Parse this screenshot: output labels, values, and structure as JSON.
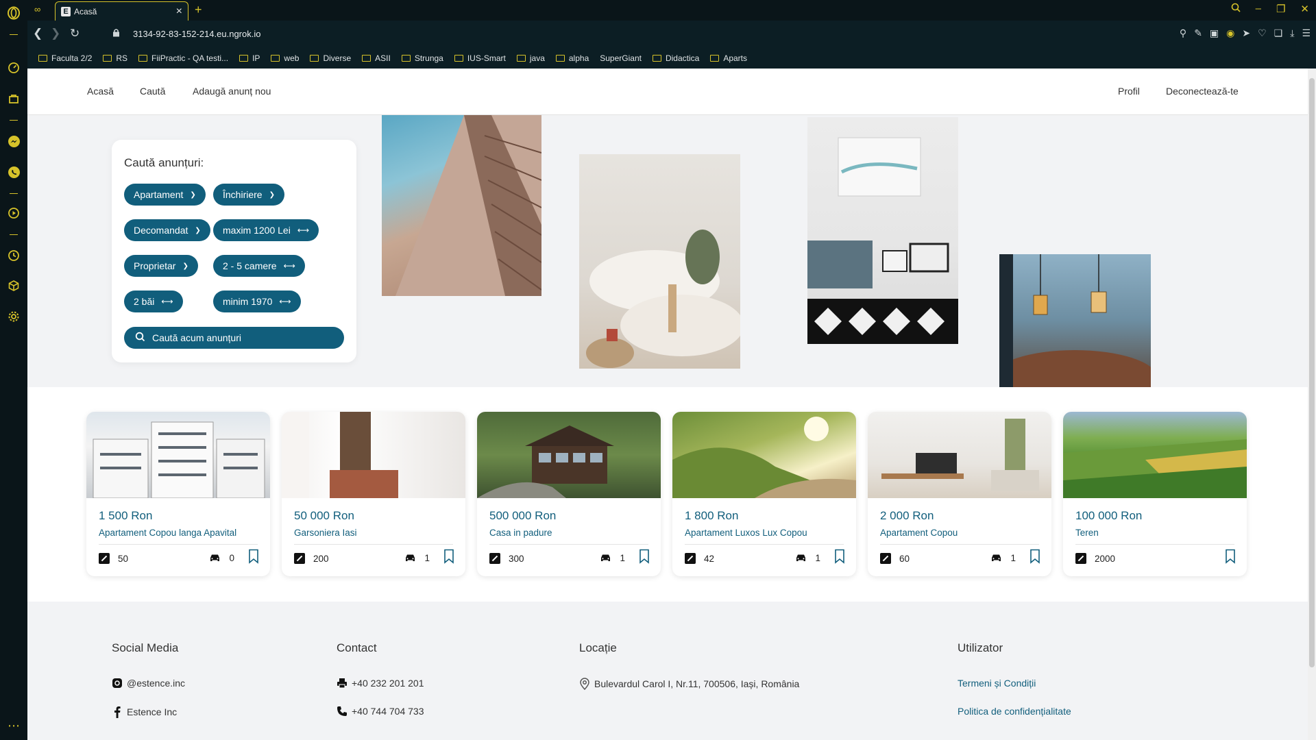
{
  "browser": {
    "tab_title": "Acasă",
    "tab_favicon_letter": "E",
    "url": "3134-92-83-152-214.eu.ngrok.io",
    "bookmarks": [
      "Faculta 2/2",
      "RS",
      "FiiPractic - QA testi...",
      "IP",
      "web",
      "Diverse",
      "ASII",
      "Strunga",
      "IUS-Smart",
      "java",
      "alpha",
      "SuperGiant",
      "Didactica",
      "Aparts"
    ],
    "accent_color": "#d7c32a"
  },
  "nav": {
    "home": "Acasă",
    "search": "Caută",
    "add": "Adaugă anunț nou",
    "profile": "Profil",
    "logout": "Deconectează-te"
  },
  "search": {
    "title": "Caută anunțuri:",
    "filters": {
      "property_type": "Apartament",
      "transaction": "Închiriere",
      "partitioning": "Decomandat",
      "price": "maxim 1200 Lei",
      "seller": "Proprietar",
      "rooms": "2 - 5 camere",
      "baths": "2 băi",
      "year": "minim 1970"
    },
    "button": "Caută acum anunțuri",
    "brand_color": "#115e7c"
  },
  "listings": [
    {
      "price": "1 500 Ron",
      "title": "Apartament Copou langa Apavital",
      "area": "50",
      "parking": "0",
      "has_parking": true
    },
    {
      "price": "50 000 Ron",
      "title": "Garsoniera Iasi",
      "area": "200",
      "parking": "1",
      "has_parking": true
    },
    {
      "price": "500 000 Ron",
      "title": "Casa in padure",
      "area": "300",
      "parking": "1",
      "has_parking": true
    },
    {
      "price": "1 800 Ron",
      "title": "Apartament Luxos Lux Copou",
      "area": "42",
      "parking": "1",
      "has_parking": true
    },
    {
      "price": "2 000 Ron",
      "title": "Apartament Copou",
      "area": "60",
      "parking": "1",
      "has_parking": true
    },
    {
      "price": "100 000 Ron",
      "title": "Teren",
      "area": "2000",
      "parking": "",
      "has_parking": false
    }
  ],
  "footer": {
    "social": {
      "title": "Social Media",
      "instagram": "@estence.inc",
      "facebook": "Estence Inc"
    },
    "contact": {
      "title": "Contact",
      "fax": "+40 232 201 201",
      "phone": "+40 744 704 733"
    },
    "location": {
      "title": "Locație",
      "address": "Bulevardul Carol I, Nr.11, 700506, Iași, România"
    },
    "user": {
      "title": "Utilizator",
      "terms": "Termeni și Condiții",
      "privacy": "Politica de confidențialitate"
    }
  }
}
